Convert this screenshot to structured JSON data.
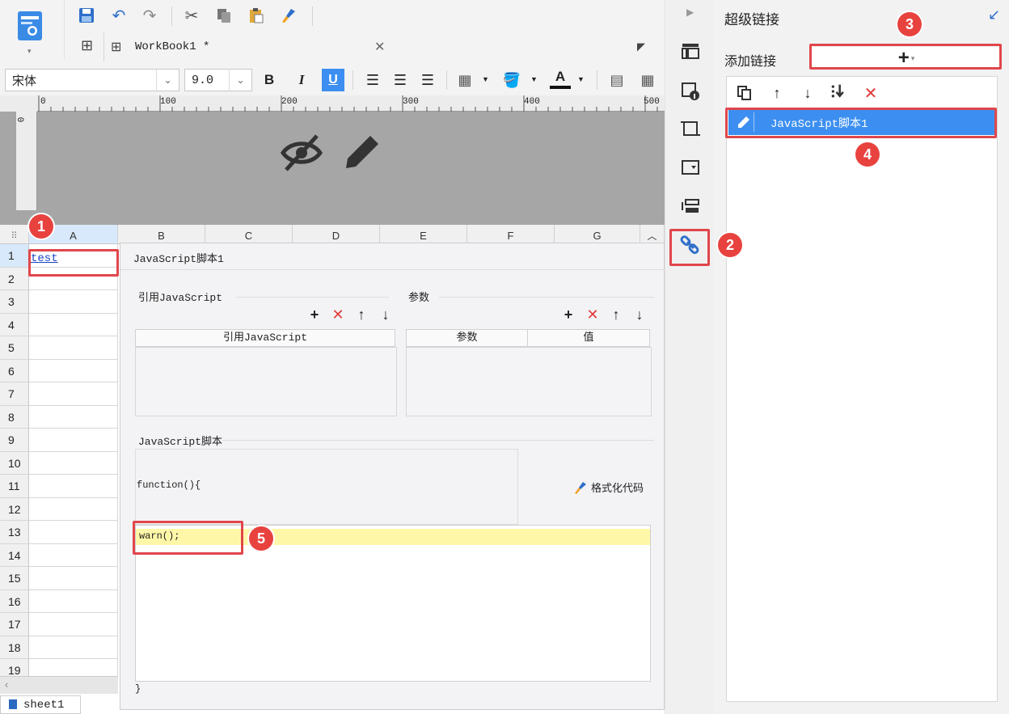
{
  "toolbar": {
    "tab_title": "WorkBook1 *",
    "font_name": "宋体",
    "font_size": "9.0"
  },
  "ruler": {
    "h_ticks": [
      "0",
      "100",
      "200",
      "300",
      "400",
      "500"
    ],
    "v_tick": "0"
  },
  "sheet": {
    "columns": [
      "A",
      "B",
      "C",
      "D",
      "E",
      "F",
      "G"
    ],
    "rows": [
      "1",
      "2",
      "3",
      "4",
      "5",
      "6",
      "7",
      "8",
      "9",
      "10",
      "11",
      "12",
      "13",
      "14",
      "15",
      "16",
      "17",
      "18",
      "19"
    ],
    "cell_a1": "test",
    "tab_name": "sheet1"
  },
  "dialog": {
    "title": "JavaScript脚本1",
    "ref_section": "引用JavaScript",
    "ref_column": "引用JavaScript",
    "params_section": "参数",
    "params_col1": "参数",
    "params_col2": "值",
    "script_section": "JavaScript脚本",
    "fn_header": "function(){",
    "format_btn": "格式化代码",
    "code_line": "warn();",
    "closing_brace": "}"
  },
  "panel": {
    "title": "超级链接",
    "add_link_label": "添加链接",
    "list_items": [
      "JavaScript脚本1"
    ]
  },
  "annotations": [
    "1",
    "2",
    "3",
    "4",
    "5"
  ],
  "colors": {
    "highlight_blue": "#3c8ff0",
    "annotation_red": "#e8423f",
    "code_line_bg": "#fff7a8"
  }
}
